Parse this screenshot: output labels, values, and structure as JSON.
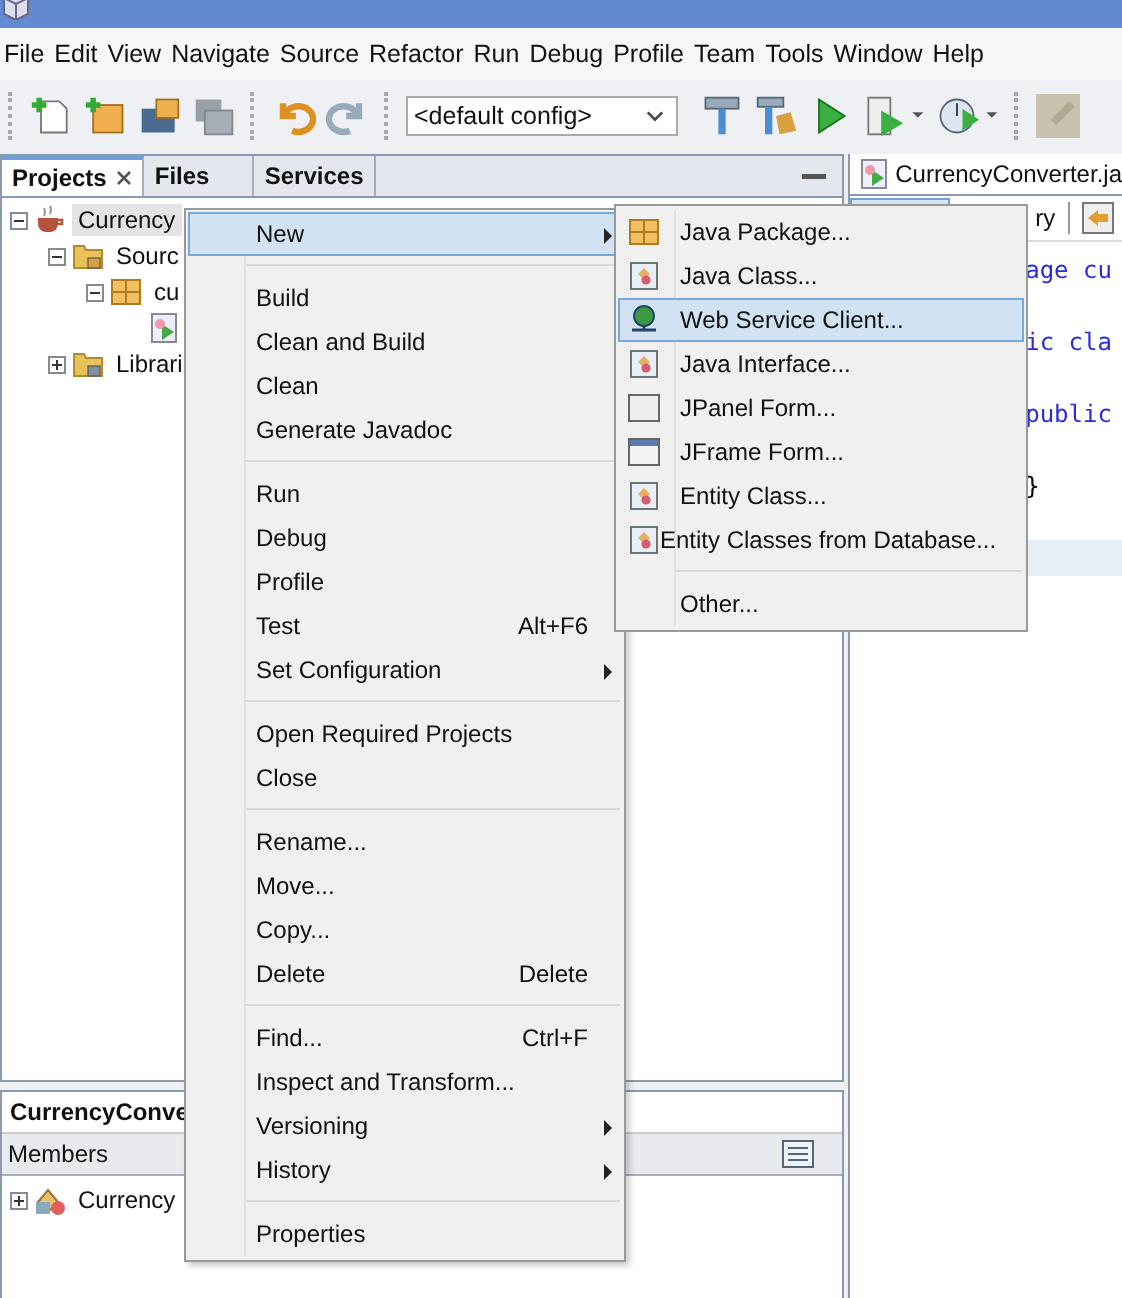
{
  "menu_bar": [
    "File",
    "Edit",
    "View",
    "Navigate",
    "Source",
    "Refactor",
    "Run",
    "Debug",
    "Profile",
    "Team",
    "Tools",
    "Window",
    "Help"
  ],
  "toolbar": {
    "config": "<default config>"
  },
  "projects_panel": {
    "tabs": [
      {
        "label": "Projects",
        "selected": true,
        "closable": true
      },
      {
        "label": "Files",
        "selected": false,
        "closable": false
      },
      {
        "label": "Services",
        "selected": false,
        "closable": false
      }
    ],
    "tree": [
      {
        "label": "Currency",
        "kind": "project",
        "expanded": true,
        "selected": true,
        "children": [
          {
            "label": "Sourc",
            "kind": "sources",
            "expanded": true,
            "selected": false,
            "children": [
              {
                "label": "cu",
                "kind": "package",
                "expanded": true,
                "selected": false,
                "children": [
                  {
                    "kind": "java-file"
                  }
                ]
              }
            ]
          },
          {
            "label": "Librari",
            "kind": "libraries",
            "expanded": false,
            "selected": false
          }
        ]
      }
    ]
  },
  "navigator_panel": {
    "title": "CurrencyConve",
    "column": "Members",
    "tree": [
      {
        "label": "Currency",
        "kind": "class",
        "expanded": false,
        "selected": false
      }
    ]
  },
  "editor": {
    "tab": "CurrencyConverter.ja",
    "view_tab": "ry",
    "lines": [
      {
        "text": "age cu",
        "kind": "keyword",
        "highlighted": false
      },
      {
        "highlighted": false
      },
      {
        "text": "ic cla",
        "kind": "keyword",
        "highlighted": false
      },
      {
        "highlighted": false
      },
      {
        "text": "public",
        "kind": "keyword",
        "highlighted": false
      },
      {
        "highlighted": false
      },
      {
        "text": "}",
        "kind": "plain",
        "highlighted": false
      },
      {
        "highlighted": false
      },
      {
        "highlighted": true
      }
    ]
  },
  "context_menu": [
    {
      "kind": "item",
      "label": "New",
      "submenu": true,
      "selected": true
    },
    {
      "kind": "separator"
    },
    {
      "kind": "item",
      "label": "Build",
      "submenu": false,
      "selected": false
    },
    {
      "kind": "item",
      "label": "Clean and Build",
      "submenu": false,
      "selected": false
    },
    {
      "kind": "item",
      "label": "Clean",
      "submenu": false,
      "selected": false
    },
    {
      "kind": "item",
      "label": "Generate Javadoc",
      "submenu": false,
      "selected": false
    },
    {
      "kind": "separator"
    },
    {
      "kind": "item",
      "label": "Run",
      "submenu": false,
      "selected": false
    },
    {
      "kind": "item",
      "label": "Debug",
      "submenu": false,
      "selected": false
    },
    {
      "kind": "item",
      "label": "Profile",
      "submenu": false,
      "selected": false
    },
    {
      "kind": "item",
      "label": "Test",
      "shortcut": "Alt+F6",
      "submenu": false,
      "selected": false
    },
    {
      "kind": "item",
      "label": "Set Configuration",
      "submenu": true,
      "selected": false
    },
    {
      "kind": "separator"
    },
    {
      "kind": "item",
      "label": "Open Required Projects",
      "submenu": false,
      "selected": false
    },
    {
      "kind": "item",
      "label": "Close",
      "submenu": false,
      "selected": false
    },
    {
      "kind": "separator"
    },
    {
      "kind": "item",
      "label": "Rename...",
      "submenu": false,
      "selected": false
    },
    {
      "kind": "item",
      "label": "Move...",
      "submenu": false,
      "selected": false
    },
    {
      "kind": "item",
      "label": "Copy...",
      "submenu": false,
      "selected": false
    },
    {
      "kind": "item",
      "label": "Delete",
      "shortcut": "Delete",
      "submenu": false,
      "selected": false
    },
    {
      "kind": "separator"
    },
    {
      "kind": "item",
      "label": "Find...",
      "shortcut": "Ctrl+F",
      "submenu": false,
      "selected": false
    },
    {
      "kind": "item",
      "label": "Inspect and Transform...",
      "submenu": false,
      "selected": false
    },
    {
      "kind": "item",
      "label": "Versioning",
      "submenu": true,
      "selected": false
    },
    {
      "kind": "item",
      "label": "History",
      "submenu": true,
      "selected": false
    },
    {
      "kind": "separator"
    },
    {
      "kind": "item",
      "label": "Properties",
      "submenu": false,
      "selected": false
    }
  ],
  "new_submenu": [
    {
      "kind": "package",
      "label": "Java Package...",
      "selected": false
    },
    {
      "kind": "class",
      "label": "Java Class...",
      "selected": false
    },
    {
      "kind": "web-service",
      "label": "Web Service Client...",
      "selected": true
    },
    {
      "kind": "class",
      "label": "Java Interface...",
      "selected": false
    },
    {
      "kind": "panel",
      "label": "JPanel Form...",
      "selected": false
    },
    {
      "kind": "frame",
      "label": "JFrame Form...",
      "selected": false
    },
    {
      "kind": "class",
      "label": "Entity Class...",
      "selected": false
    },
    {
      "kind": "class",
      "label": "Entity Classes from Database...",
      "selected": false
    },
    {
      "kind": "separator"
    },
    {
      "kind": "other",
      "label": "Other...",
      "selected": false
    }
  ]
}
